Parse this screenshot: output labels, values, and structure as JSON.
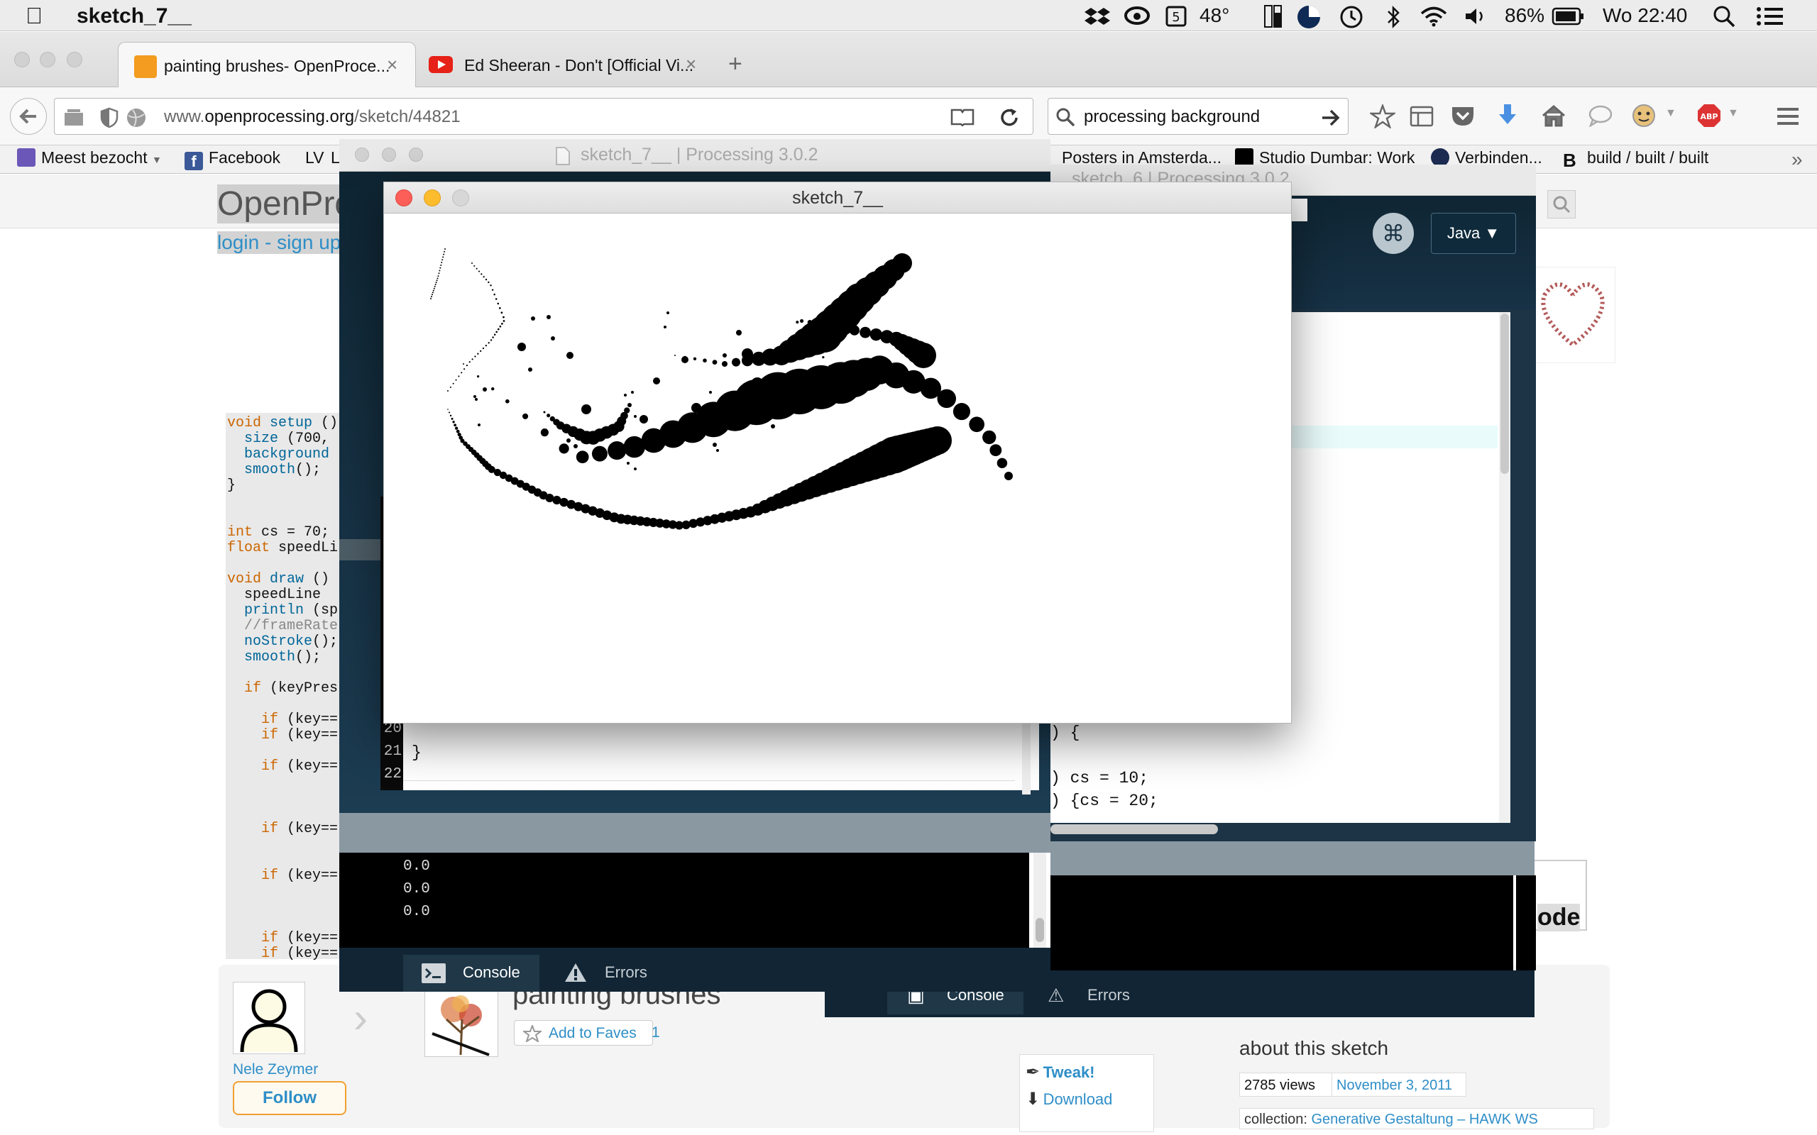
{
  "menubar": {
    "app_name": "sketch_7__",
    "temperature": "48°",
    "battery": "86%",
    "clock": "Wo 22:40"
  },
  "browser": {
    "tabs": [
      {
        "title": "painting brushes- OpenProce...",
        "favicon_color": "#f39c1f"
      },
      {
        "title": "Ed Sheeran - Don't [Official Vi...",
        "favicon_color": "#e62117"
      }
    ],
    "url_host": "www.",
    "url_domain": "openprocessing.org",
    "url_path": "/sketch/44821",
    "search_value": "processing background",
    "adblock_label": "ABP",
    "bookmarks": [
      {
        "label": "Meest bezocht",
        "icon_color": "#6b57b8"
      },
      {
        "label": "Facebook",
        "icon_color": "#3b5998"
      },
      {
        "label": "LV",
        "icon_color": ""
      },
      {
        "label": "L",
        "icon_color": ""
      },
      {
        "label": "Posters in Amsterda...",
        "icon_color": ""
      },
      {
        "label": "Studio Dumbar: Work",
        "icon_color": "#000000"
      },
      {
        "label": "Verbinden...",
        "icon_color": "#1a2a50"
      },
      {
        "label": "build / built / built",
        "icon_color": "#ffffff"
      }
    ]
  },
  "webpage": {
    "logo_text": "OpenPro",
    "login": "login",
    "dash": "-",
    "signup": "sign up",
    "code_lines": [
      {
        "kw": "void ",
        "fn": "setup",
        "rest": " ()"
      },
      {
        "kw": "",
        "fn": "  size",
        "rest": " (700,"
      },
      {
        "kw": "",
        "fn": "  background",
        "rest": ""
      },
      {
        "kw": "",
        "fn": "  smooth",
        "rest": "();"
      },
      {
        "kw": "",
        "fn": "",
        "rest": "}"
      },
      {
        "kw": "",
        "fn": "",
        "rest": ""
      },
      {
        "kw": "",
        "fn": "",
        "rest": ""
      },
      {
        "kw": "int",
        "fn": "",
        "rest": " cs = 70;"
      },
      {
        "kw": "float",
        "fn": "",
        "rest": " speedLi"
      },
      {
        "kw": "",
        "fn": "",
        "rest": ""
      },
      {
        "kw": "void ",
        "fn": "draw",
        "rest": " ()"
      },
      {
        "kw": "",
        "fn": "",
        "rest": "  speedLine"
      },
      {
        "kw": "",
        "fn": "  println",
        "rest": " (sp"
      },
      {
        "kw": "",
        "fn": "",
        "rest": "  //frameRate"
      },
      {
        "kw": "",
        "fn": "  noStroke",
        "rest": "();"
      },
      {
        "kw": "",
        "fn": "  smooth",
        "rest": "();"
      },
      {
        "kw": "",
        "fn": "",
        "rest": ""
      },
      {
        "kw": "  if",
        "fn": "",
        "rest": " (keyPres"
      },
      {
        "kw": "",
        "fn": "",
        "rest": ""
      },
      {
        "kw": "    if",
        "fn": "",
        "rest": " (key=="
      },
      {
        "kw": "    if",
        "fn": "",
        "rest": " (key=="
      },
      {
        "kw": "",
        "fn": "",
        "rest": ""
      },
      {
        "kw": "    if",
        "fn": "",
        "rest": " (key=="
      },
      {
        "kw": "",
        "fn": "",
        "rest": ""
      },
      {
        "kw": "",
        "fn": "",
        "rest": ""
      },
      {
        "kw": "",
        "fn": "",
        "rest": ""
      },
      {
        "kw": "    if",
        "fn": "",
        "rest": " (key=="
      },
      {
        "kw": "",
        "fn": "",
        "rest": ""
      },
      {
        "kw": "",
        "fn": "",
        "rest": ""
      },
      {
        "kw": "    if",
        "fn": "",
        "rest": " (key=="
      },
      {
        "kw": "",
        "fn": "",
        "rest": ""
      },
      {
        "kw": "",
        "fn": "",
        "rest": ""
      },
      {
        "kw": "",
        "fn": "",
        "rest": ""
      },
      {
        "kw": "    if",
        "fn": "",
        "rest": " (key=="
      },
      {
        "kw": "    if",
        "fn": "",
        "rest": " (key=="
      }
    ],
    "author": "Nele Zeymer",
    "follow": "Follow",
    "sketch_title": "painting brushes",
    "add_to_faves": "Add to Faves",
    "faves_count": "1",
    "tweak": "Tweak!",
    "download": "Download",
    "about_title": "about this sketch",
    "views": "2785 views",
    "date": "November 3, 2011",
    "collection_label": "collection:",
    "collection_value": "Generative Gestaltung – HAWK WS",
    "code_badge": "ode"
  },
  "pde6": {
    "title": "sketch_6 | Processing 3.0.2",
    "mode": "Java ▼",
    "code": [
      ") {",
      "",
      ") cs = 10;",
      ") {cs = 20;"
    ],
    "tabs": [
      "Console",
      "Errors"
    ]
  },
  "pde7": {
    "title": "sketch_7__ | Processing 3.0.2",
    "line_numbers": [
      "20",
      "21",
      "22"
    ],
    "code_brace": "}",
    "console": [
      "0.0",
      "0.0",
      "0.0"
    ],
    "tabs": [
      "Console",
      "Errors"
    ]
  },
  "sketch_window": {
    "title": "sketch_7__"
  }
}
